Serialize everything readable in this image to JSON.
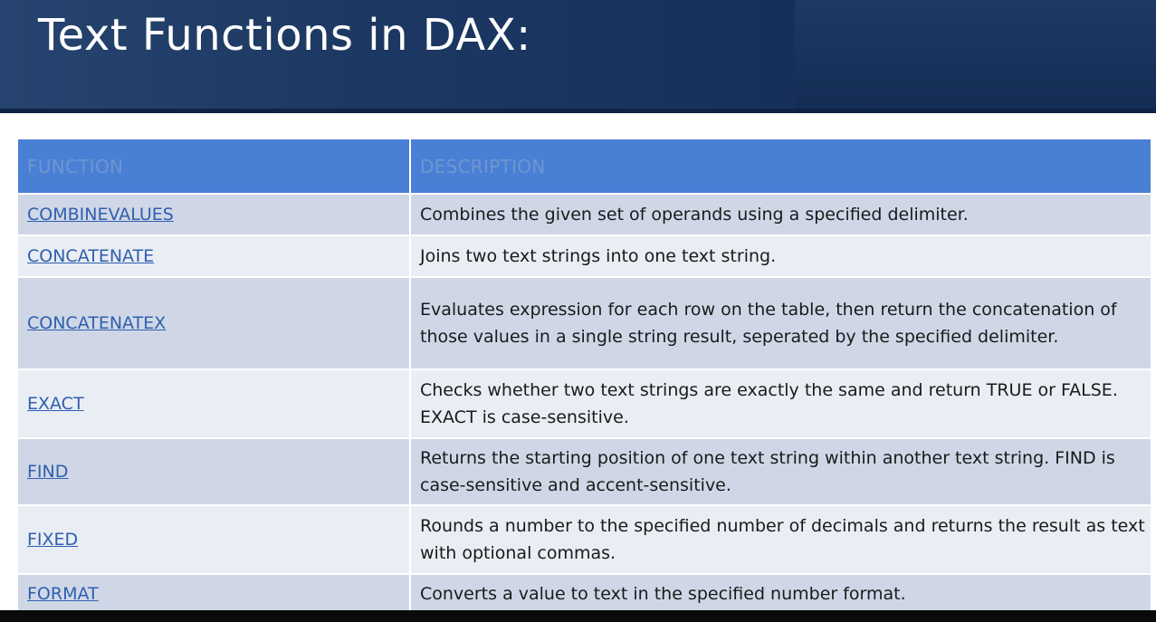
{
  "slide": {
    "title": "Text Functions in DAX:"
  },
  "table": {
    "headers": [
      "FUNCTION",
      "DESCRIPTION"
    ],
    "rows": [
      {
        "function": "COMBINEVALUES",
        "description": "Combines the given set of operands using a specified delimiter."
      },
      {
        "function": "CONCATENATE",
        "description": "Joins two text strings into one text string."
      },
      {
        "function": "CONCATENATEX",
        "description": "Evaluates expression for each row on the table, then return the concatenation of those values in a single string result, seperated by the specified delimiter."
      },
      {
        "function": "EXACT",
        "description": "Checks whether two text strings are exactly the same and return TRUE or FALSE. EXACT is case-sensitive."
      },
      {
        "function": "FIND",
        "description": "Returns the starting position of one text string within another text string. FIND is case-sensitive and accent-sensitive."
      },
      {
        "function": "FIXED",
        "description": "Rounds a number to the specified number of decimals and returns the result as text with optional commas."
      },
      {
        "function": "FORMAT",
        "description": "Converts a value to text in the specified number format."
      }
    ]
  },
  "colors": {
    "banner": "#1d3963",
    "header_fill": "#4a7fd6",
    "row_odd": "#cfd7e7",
    "row_even": "#e9edf4",
    "link": "#2f5fae"
  }
}
